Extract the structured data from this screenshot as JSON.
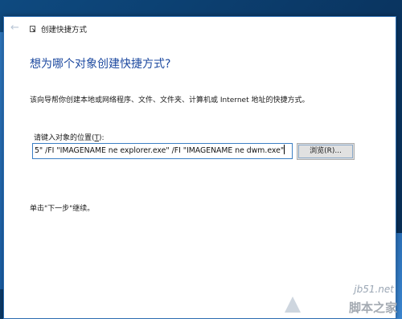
{
  "window": {
    "title": "创建快捷方式",
    "back_icon": "back-arrow-icon",
    "app_icon": "shortcut-icon"
  },
  "page": {
    "heading": "想为哪个对象创建快捷方式?",
    "description": "该向导帮你创建本地或网络程序、文件、文件夹、计算机或 Internet 地址的快捷方式。",
    "location_label": "请键入对象的位置(",
    "location_label_key": "T",
    "location_label_end": "):",
    "location_value": "5\" /FI \"IMAGENAME ne explorer.exe\" /FI \"IMAGENAME ne dwm.exe\"",
    "browse_label": "浏览(R)...",
    "hint": "单击\"下一步\"继续。"
  },
  "watermark": {
    "site": "jb51.net",
    "brand": "脚本之家"
  },
  "colors": {
    "heading": "#1e4aa0",
    "desktop": "#0a3561",
    "input_border": "#3c7fc4"
  }
}
